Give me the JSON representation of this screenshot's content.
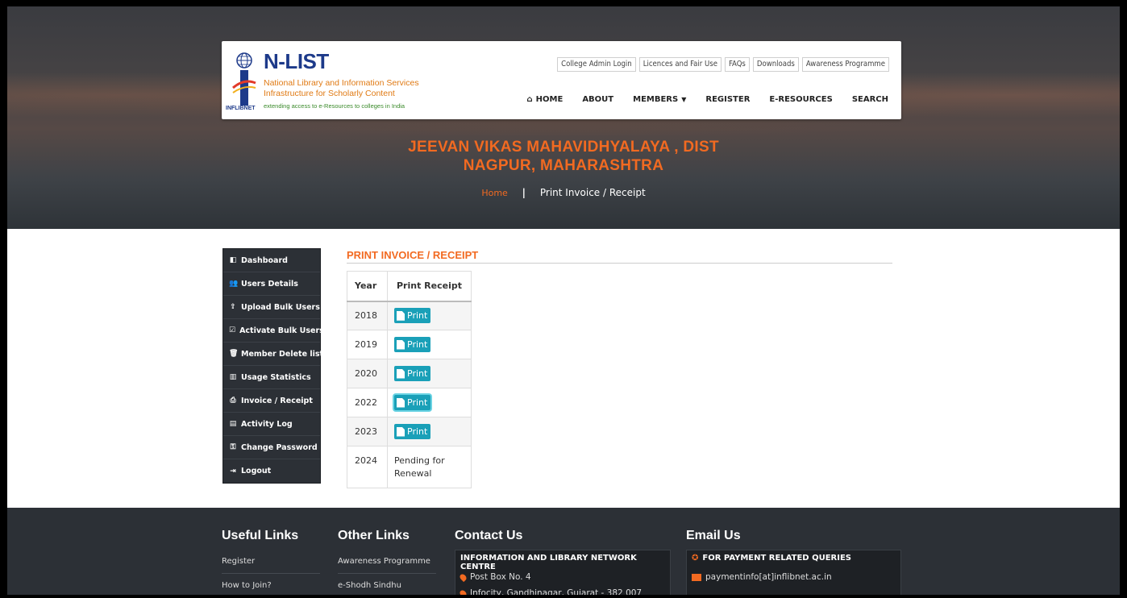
{
  "header": {
    "logo_title": "N-LIST",
    "logo_sub1": "National Library and Information Services",
    "logo_sub2": "Infrastructure for Scholarly Content",
    "logo_sub3": "extending access to e-Resources to colleges in India",
    "logo_org": "INFLIBNET",
    "top_links": [
      "College Admin Login",
      "Licences and Fair Use",
      "FAQs",
      "Downloads",
      "Awareness Programme"
    ],
    "nav": {
      "home": "HOME",
      "about": "ABOUT",
      "members": "MEMBERS",
      "register": "REGISTER",
      "eresources": "E-RESOURCES",
      "search": "SEARCH"
    }
  },
  "hero": {
    "title_line1": "JEEVAN VIKAS MAHAVIDHYALAYA , DIST",
    "title_line2": "NAGPUR, MAHARASHTRA",
    "breadcrumb_home": "Home",
    "breadcrumb_sep": "|",
    "breadcrumb_current": "Print Invoice / Receipt"
  },
  "sidebar": {
    "items": [
      {
        "label": "Dashboard",
        "icon": "dashboard-icon",
        "glyph": "◧"
      },
      {
        "label": "Users Details",
        "icon": "users-icon",
        "glyph": "👥"
      },
      {
        "label": "Upload Bulk Users",
        "icon": "upload-users-icon",
        "glyph": "⇪"
      },
      {
        "label": "Activate Bulk Users",
        "icon": "check-square-icon",
        "glyph": "☑"
      },
      {
        "label": "Member Delete list",
        "icon": "trash-icon",
        "glyph": "🗑"
      },
      {
        "label": "Usage Statistics",
        "icon": "bar-chart-icon",
        "glyph": "▥"
      },
      {
        "label": "Invoice / Receipt",
        "icon": "printer-icon",
        "glyph": "⎙"
      },
      {
        "label": "Activity Log",
        "icon": "list-icon",
        "glyph": "▤"
      },
      {
        "label": "Change Password",
        "icon": "key-icon",
        "glyph": "⚿"
      },
      {
        "label": "Logout",
        "icon": "logout-icon",
        "glyph": "⇥"
      }
    ]
  },
  "main": {
    "section_title": "PRINT INVOICE / RECEIPT",
    "table": {
      "headers": [
        "Year",
        "Print Receipt"
      ],
      "print_label": "Print",
      "rows": [
        {
          "year": "2018",
          "status": "print"
        },
        {
          "year": "2019",
          "status": "print"
        },
        {
          "year": "2020",
          "status": "print"
        },
        {
          "year": "2022",
          "status": "print"
        },
        {
          "year": "2023",
          "status": "print"
        },
        {
          "year": "2024",
          "status": "pending",
          "pending_text": "Pending for Renewal"
        }
      ]
    }
  },
  "footer": {
    "useful_links_title": "Useful Links",
    "useful_links": [
      "Register",
      "How to Join?"
    ],
    "other_links_title": "Other Links",
    "other_links": [
      "Awareness Programme",
      "e-Shodh Sindhu"
    ],
    "contact_title": "Contact Us",
    "contact_org": "INFORMATION AND LIBRARY NETWORK CENTRE",
    "contact_po": "Post Box No. 4",
    "contact_addr": "Infocity, Gandhinagar, Gujarat - 382 007",
    "email_title": "Email Us",
    "email_head": "FOR PAYMENT RELATED QUERIES",
    "email_payment": "paymentinfo[at]inflibnet.ac.in"
  },
  "colors": {
    "accent": "#f26a21",
    "print_button": "#1aa0b8",
    "sidebar_bg": "#2c3036",
    "logo_blue": "#1d3a8a"
  }
}
